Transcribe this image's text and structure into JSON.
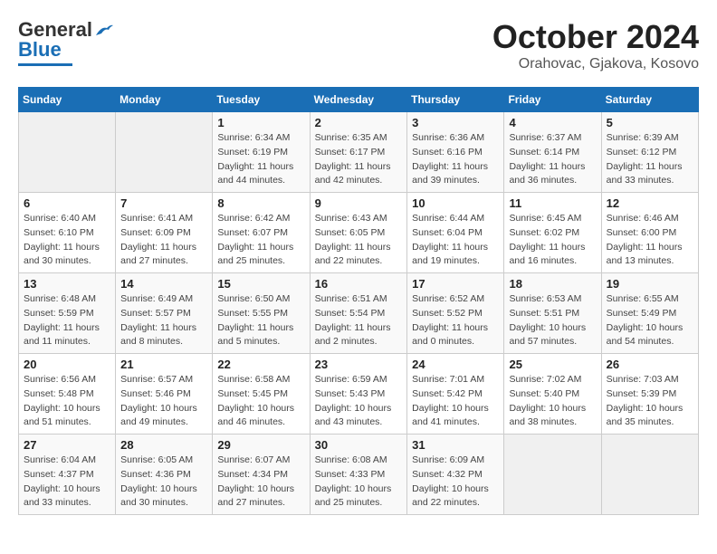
{
  "header": {
    "logo_general": "General",
    "logo_blue": "Blue",
    "month_title": "October 2024",
    "location": "Orahovac, Gjakova, Kosovo"
  },
  "days_of_week": [
    "Sunday",
    "Monday",
    "Tuesday",
    "Wednesday",
    "Thursday",
    "Friday",
    "Saturday"
  ],
  "weeks": [
    [
      {
        "day": "",
        "info": ""
      },
      {
        "day": "",
        "info": ""
      },
      {
        "day": "1",
        "sunrise": "6:34 AM",
        "sunset": "6:19 PM",
        "daylight": "11 hours and 44 minutes."
      },
      {
        "day": "2",
        "sunrise": "6:35 AM",
        "sunset": "6:17 PM",
        "daylight": "11 hours and 42 minutes."
      },
      {
        "day": "3",
        "sunrise": "6:36 AM",
        "sunset": "6:16 PM",
        "daylight": "11 hours and 39 minutes."
      },
      {
        "day": "4",
        "sunrise": "6:37 AM",
        "sunset": "6:14 PM",
        "daylight": "11 hours and 36 minutes."
      },
      {
        "day": "5",
        "sunrise": "6:39 AM",
        "sunset": "6:12 PM",
        "daylight": "11 hours and 33 minutes."
      }
    ],
    [
      {
        "day": "6",
        "sunrise": "6:40 AM",
        "sunset": "6:10 PM",
        "daylight": "11 hours and 30 minutes."
      },
      {
        "day": "7",
        "sunrise": "6:41 AM",
        "sunset": "6:09 PM",
        "daylight": "11 hours and 27 minutes."
      },
      {
        "day": "8",
        "sunrise": "6:42 AM",
        "sunset": "6:07 PM",
        "daylight": "11 hours and 25 minutes."
      },
      {
        "day": "9",
        "sunrise": "6:43 AM",
        "sunset": "6:05 PM",
        "daylight": "11 hours and 22 minutes."
      },
      {
        "day": "10",
        "sunrise": "6:44 AM",
        "sunset": "6:04 PM",
        "daylight": "11 hours and 19 minutes."
      },
      {
        "day": "11",
        "sunrise": "6:45 AM",
        "sunset": "6:02 PM",
        "daylight": "11 hours and 16 minutes."
      },
      {
        "day": "12",
        "sunrise": "6:46 AM",
        "sunset": "6:00 PM",
        "daylight": "11 hours and 13 minutes."
      }
    ],
    [
      {
        "day": "13",
        "sunrise": "6:48 AM",
        "sunset": "5:59 PM",
        "daylight": "11 hours and 11 minutes."
      },
      {
        "day": "14",
        "sunrise": "6:49 AM",
        "sunset": "5:57 PM",
        "daylight": "11 hours and 8 minutes."
      },
      {
        "day": "15",
        "sunrise": "6:50 AM",
        "sunset": "5:55 PM",
        "daylight": "11 hours and 5 minutes."
      },
      {
        "day": "16",
        "sunrise": "6:51 AM",
        "sunset": "5:54 PM",
        "daylight": "11 hours and 2 minutes."
      },
      {
        "day": "17",
        "sunrise": "6:52 AM",
        "sunset": "5:52 PM",
        "daylight": "11 hours and 0 minutes."
      },
      {
        "day": "18",
        "sunrise": "6:53 AM",
        "sunset": "5:51 PM",
        "daylight": "10 hours and 57 minutes."
      },
      {
        "day": "19",
        "sunrise": "6:55 AM",
        "sunset": "5:49 PM",
        "daylight": "10 hours and 54 minutes."
      }
    ],
    [
      {
        "day": "20",
        "sunrise": "6:56 AM",
        "sunset": "5:48 PM",
        "daylight": "10 hours and 51 minutes."
      },
      {
        "day": "21",
        "sunrise": "6:57 AM",
        "sunset": "5:46 PM",
        "daylight": "10 hours and 49 minutes."
      },
      {
        "day": "22",
        "sunrise": "6:58 AM",
        "sunset": "5:45 PM",
        "daylight": "10 hours and 46 minutes."
      },
      {
        "day": "23",
        "sunrise": "6:59 AM",
        "sunset": "5:43 PM",
        "daylight": "10 hours and 43 minutes."
      },
      {
        "day": "24",
        "sunrise": "7:01 AM",
        "sunset": "5:42 PM",
        "daylight": "10 hours and 41 minutes."
      },
      {
        "day": "25",
        "sunrise": "7:02 AM",
        "sunset": "5:40 PM",
        "daylight": "10 hours and 38 minutes."
      },
      {
        "day": "26",
        "sunrise": "7:03 AM",
        "sunset": "5:39 PM",
        "daylight": "10 hours and 35 minutes."
      }
    ],
    [
      {
        "day": "27",
        "sunrise": "6:04 AM",
        "sunset": "4:37 PM",
        "daylight": "10 hours and 33 minutes."
      },
      {
        "day": "28",
        "sunrise": "6:05 AM",
        "sunset": "4:36 PM",
        "daylight": "10 hours and 30 minutes."
      },
      {
        "day": "29",
        "sunrise": "6:07 AM",
        "sunset": "4:34 PM",
        "daylight": "10 hours and 27 minutes."
      },
      {
        "day": "30",
        "sunrise": "6:08 AM",
        "sunset": "4:33 PM",
        "daylight": "10 hours and 25 minutes."
      },
      {
        "day": "31",
        "sunrise": "6:09 AM",
        "sunset": "4:32 PM",
        "daylight": "10 hours and 22 minutes."
      },
      {
        "day": "",
        "info": ""
      },
      {
        "day": "",
        "info": ""
      }
    ]
  ],
  "labels": {
    "sunrise_label": "Sunrise:",
    "sunset_label": "Sunset:",
    "daylight_label": "Daylight:"
  }
}
